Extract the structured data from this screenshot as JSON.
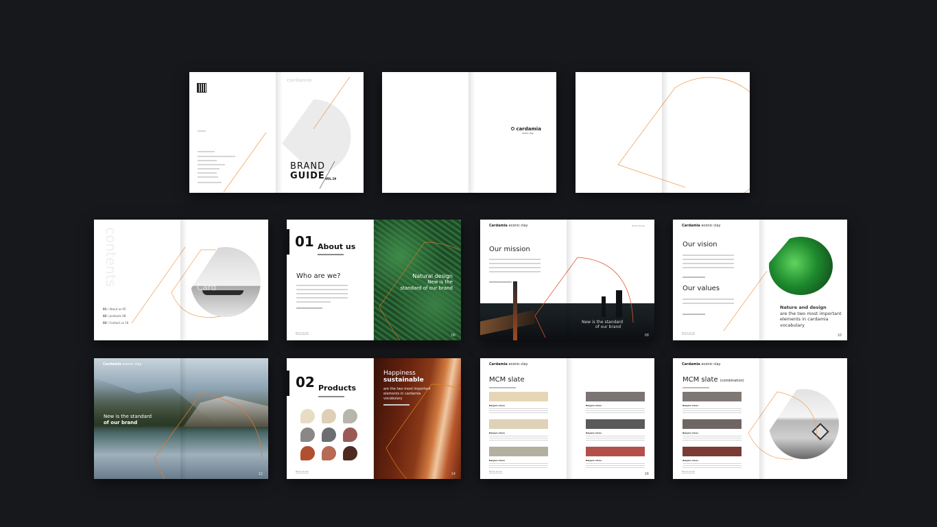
{
  "colors": {
    "background": "#17181c",
    "accent": "#f0a05a",
    "mission_arc": "#e0552f"
  },
  "brand": {
    "logo": "cardamia",
    "logo_sub": "econic clay",
    "header": "Cardamia",
    "header_suffix": "econic clay",
    "footer": "Brand Guide"
  },
  "cover": {
    "title_line1": "BRAND",
    "title_line2": "GUIDE",
    "volume": "VOL.19"
  },
  "contents": {
    "title": "contents",
    "watermark": "Card",
    "items": [
      {
        "num": "01",
        "label": "About us",
        "page": "05"
      },
      {
        "num": "02",
        "label": "products",
        "page": "08"
      },
      {
        "num": "03",
        "label": "Contact us",
        "page": "16"
      }
    ]
  },
  "about": {
    "num": "01",
    "title": "About us",
    "heading": "Who are we?",
    "overlay_title": "Natural  design",
    "overlay_line1": "New is the",
    "overlay_line2": "standard of our brand",
    "page": "06"
  },
  "mission": {
    "heading": "Our mission",
    "overlay_line1": "New is the standard",
    "overlay_line2": "of our brand",
    "page": "08"
  },
  "vision": {
    "heading1": "Our vision",
    "heading2": "Our values",
    "caption_title": "Nature and design",
    "caption_body": "are the two most important elements in cardamia vocabulary",
    "page": "10"
  },
  "landscape": {
    "line1": "New is the standard",
    "line2": "of our brand",
    "page": "12"
  },
  "products": {
    "num": "02",
    "title": "Products",
    "overlay_title1": "Happiness",
    "overlay_title2": "sustainable",
    "overlay_body": "are the two most important elements in cardamia vocabulary",
    "page": "14",
    "swatch_colors": [
      "#e8dcc4",
      "#ddd0b6",
      "#b8b6ac",
      "#8a8886",
      "#6c6e70",
      "#9a5a58",
      "#b0502e",
      "#b86a52",
      "#4e2a22"
    ]
  },
  "slate": {
    "heading": "MCM slate",
    "item_label": "Balgam stone",
    "page": "16",
    "colors": [
      "#e6d6b4",
      "#ded2b8",
      "#b4b0a0",
      "#7a7472",
      "#5a5a5a",
      "#b4504a"
    ]
  },
  "slate_combo": {
    "heading": "MCM slate",
    "heading_suffix": "(combination)",
    "item_label": "Balgam stone",
    "colors": [
      "#7e7874",
      "#6e6662",
      "#7a3a36"
    ]
  }
}
